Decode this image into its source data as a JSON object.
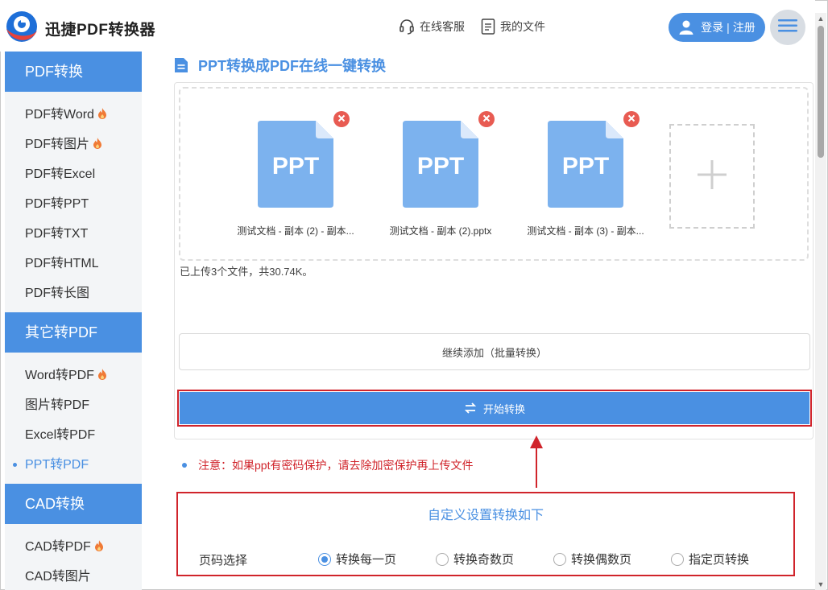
{
  "header": {
    "brand": "迅捷PDF转换器",
    "service_label": "在线客服",
    "files_label": "我的文件",
    "login_label": "登录",
    "login_sep": "|",
    "register_label": "注册"
  },
  "sidebar": {
    "groups": [
      {
        "title": "PDF转换",
        "items": [
          {
            "label": "PDF转Word",
            "hot": true
          },
          {
            "label": "PDF转图片",
            "hot": true
          },
          {
            "label": "PDF转Excel",
            "hot": false
          },
          {
            "label": "PDF转PPT",
            "hot": false
          },
          {
            "label": "PDF转TXT",
            "hot": false
          },
          {
            "label": "PDF转HTML",
            "hot": false
          },
          {
            "label": "PDF转长图",
            "hot": false
          }
        ]
      },
      {
        "title": "其它转PDF",
        "items": [
          {
            "label": "Word转PDF",
            "hot": true
          },
          {
            "label": "图片转PDF",
            "hot": false
          },
          {
            "label": "Excel转PDF",
            "hot": false
          },
          {
            "label": "PPT转PDF",
            "hot": false,
            "active": true
          }
        ]
      },
      {
        "title": "CAD转换",
        "items": [
          {
            "label": "CAD转PDF",
            "hot": true
          },
          {
            "label": "CAD转图片",
            "hot": false
          }
        ]
      }
    ]
  },
  "main": {
    "title": "PPT转换成PDF在线一键转换",
    "files": [
      {
        "type_label": "PPT",
        "name": "测试文档 - 副本 (2) - 副本..."
      },
      {
        "type_label": "PPT",
        "name": "测试文档 - 副本 (2).pptx"
      },
      {
        "type_label": "PPT",
        "name": "测试文档 - 副本 (3) - 副本..."
      }
    ],
    "upload_info": "已上传3个文件，共30.74K。",
    "continue_label": "继续添加（批量转换）",
    "start_label": "开始转换",
    "notice": "注意：如果ppt有密码保护，请去除加密保护再上传文件"
  },
  "settings": {
    "title": "自定义设置转换如下",
    "page_label": "页码选择",
    "options": [
      "转换每一页",
      "转换奇数页",
      "转换偶数页",
      "指定页转换"
    ],
    "selected_index": 0
  },
  "colors": {
    "accent": "#4a90e2",
    "highlight_red": "#d0242b",
    "file_icon": "#7cb2ee",
    "delete_red": "#e85b52"
  },
  "icons": {
    "logo": "app-logo",
    "service": "headset-icon",
    "files": "document-icon",
    "user": "user-icon",
    "menu": "hamburger-menu-icon",
    "fire": "fire-icon",
    "title": "document-icon",
    "delete": "close-icon",
    "add": "plus-icon",
    "start": "swap-icon"
  }
}
